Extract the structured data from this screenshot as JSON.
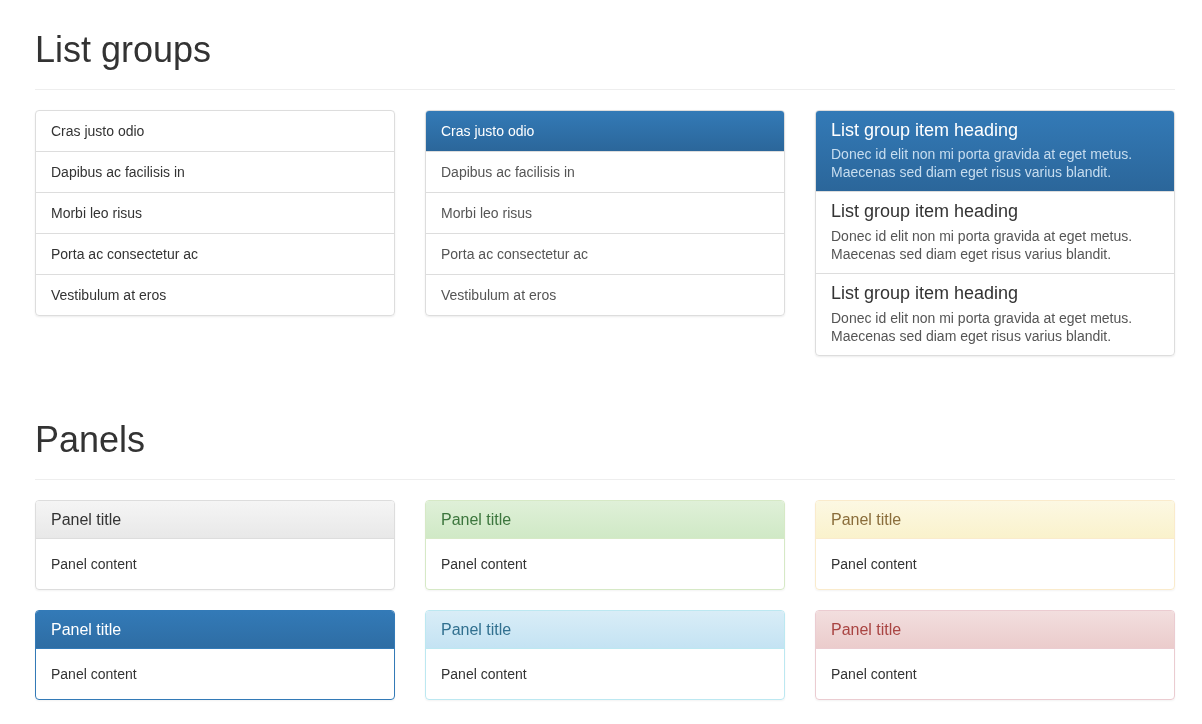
{
  "sections": [
    {
      "title": "List groups",
      "list_groups": [
        {
          "kind": "plain",
          "items": [
            {
              "text": "Cras justo odio",
              "selected": false
            },
            {
              "text": "Dapibus ac facilisis in",
              "selected": false
            },
            {
              "text": "Morbi leo risus",
              "selected": false
            },
            {
              "text": "Porta ac consectetur ac",
              "selected": false
            },
            {
              "text": "Vestibulum at eros",
              "selected": false
            }
          ]
        },
        {
          "kind": "link",
          "items": [
            {
              "text": "Cras justo odio",
              "selected": true
            },
            {
              "text": "Dapibus ac facilisis in",
              "selected": false
            },
            {
              "text": "Morbi leo risus",
              "selected": false
            },
            {
              "text": "Porta ac consectetur ac",
              "selected": false
            },
            {
              "text": "Vestibulum at eros",
              "selected": false
            }
          ]
        },
        {
          "kind": "custom",
          "items": [
            {
              "heading": "List group item heading",
              "text": "Donec id elit non mi porta gravida at eget metus. Maecenas sed diam eget risus varius blandit.",
              "selected": true
            },
            {
              "heading": "List group item heading",
              "text": "Donec id elit non mi porta gravida at eget metus. Maecenas sed diam eget risus varius blandit.",
              "selected": false
            },
            {
              "heading": "List group item heading",
              "text": "Donec id elit non mi porta gravida at eget metus. Maecenas sed diam eget risus varius blandit.",
              "selected": false
            }
          ]
        }
      ]
    },
    {
      "title": "Panels",
      "panels": [
        {
          "kind": "default",
          "title": "Panel title",
          "content": "Panel content"
        },
        {
          "kind": "success",
          "title": "Panel title",
          "content": "Panel content"
        },
        {
          "kind": "warning",
          "title": "Panel title",
          "content": "Panel content"
        },
        {
          "kind": "primary",
          "title": "Panel title",
          "content": "Panel content"
        },
        {
          "kind": "info",
          "title": "Panel title",
          "content": "Panel content"
        },
        {
          "kind": "danger",
          "title": "Panel title",
          "content": "Panel content"
        }
      ]
    }
  ]
}
